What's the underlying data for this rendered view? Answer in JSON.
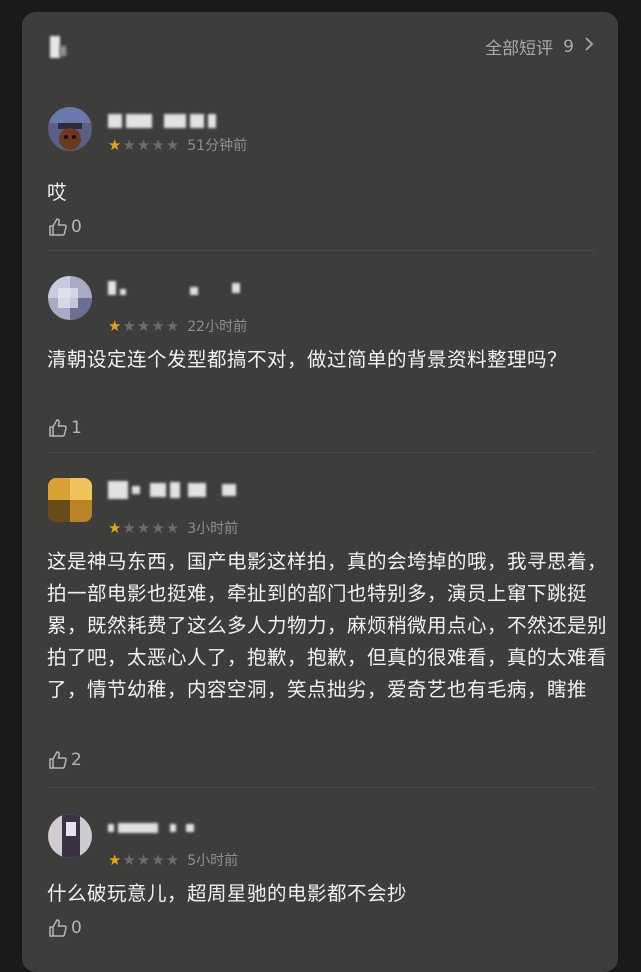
{
  "header": {
    "all_reviews_label": "全部短评",
    "all_reviews_count": "9",
    "chevron_icon": "chevron-right-icon"
  },
  "reviews": [
    {
      "rating": 1,
      "time": "51分钟前",
      "text": "哎",
      "likes": "0"
    },
    {
      "rating": 1,
      "time": "22小时前",
      "text": "清朝设定连个发型都搞不对，做过简单的背景资料整理吗？",
      "likes": "1"
    },
    {
      "rating": 1,
      "time": "3小时前",
      "text": "这是神马东西，国产电影这样拍，真的会垮掉的哦，我寻思着，拍一部电影也挺难，牵扯到的部门也特别多，演员上窜下跳挺累，既然耗费了这么多人力物力，麻烦稍微用点心，不然还是别拍了吧，太恶心人了，抱歉，抱歉，但真的很难看，真的太难看了，情节幼稚，内容空洞，笑点拙劣，爱奇艺也有毛病，瞎推",
      "likes": "2"
    },
    {
      "rating": 1,
      "time": "5小时前",
      "text": "什么破玩意儿，超周星驰的电影都不会抄",
      "likes": "0"
    }
  ],
  "colors": {
    "panel_bg": "#3d3d3b",
    "star_on": "#e2a21a",
    "star_off": "#6c6c6c",
    "text": "#f1f1f1",
    "meta": "#8e8e8e"
  }
}
